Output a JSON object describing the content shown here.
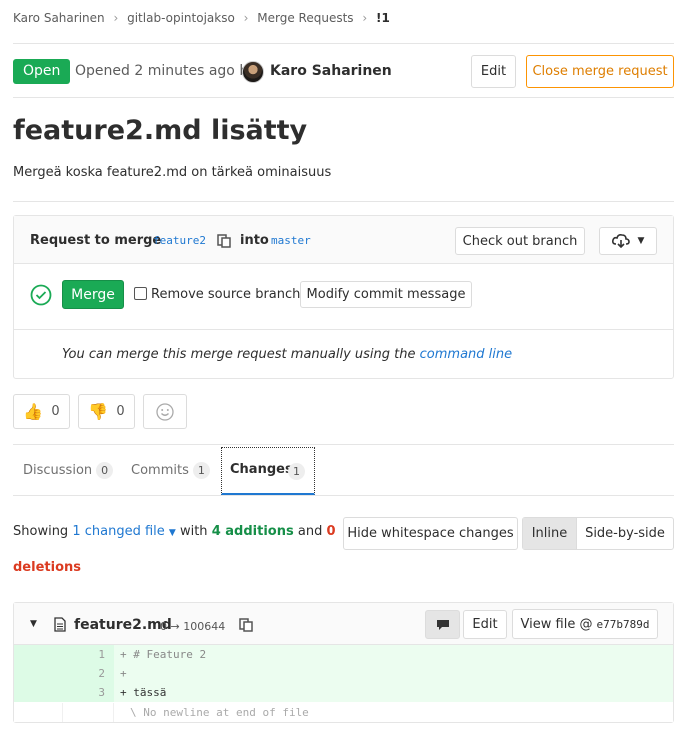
{
  "breadcrumb": {
    "items": [
      "Karo Saharinen",
      "gitlab-opintojakso",
      "Merge Requests",
      "!1"
    ],
    "separator": "›"
  },
  "header": {
    "status": "Open",
    "opened_text": "Opened",
    "time_ago": "2 minutes ago",
    "by_text": "by",
    "author": "Karo Saharinen",
    "edit_label": "Edit",
    "close_label": "Close merge request"
  },
  "title": "feature2.md lisätty",
  "description": "Mergeä koska feature2.md on tärkeä ominaisuus",
  "merge_widget": {
    "request_text": "Request to merge",
    "source_branch": "feature2",
    "into_text": "into",
    "target_branch": "master",
    "checkout_label": "Check out branch",
    "merge_label": "Merge",
    "remove_source_label": "Remove source branch",
    "modify_commit_label": "Modify commit message",
    "manual_text": "You can merge this merge request manually using the",
    "command_line_link": "command line"
  },
  "awards": {
    "thumbs_up": "0",
    "thumbs_down": "0"
  },
  "tabs": [
    {
      "label": "Discussion",
      "count": "0"
    },
    {
      "label": "Commits",
      "count": "1"
    },
    {
      "label": "Changes",
      "count": "1"
    }
  ],
  "diff_summary": {
    "showing": "Showing",
    "changed_files": "1 changed file",
    "with": "with",
    "additions": "4 additions",
    "and": "and",
    "deletions_count": "0",
    "deletions_word": "deletions",
    "hide_whitespace_label": "Hide whitespace changes",
    "inline_label": "Inline",
    "side_by_side_label": "Side-by-side"
  },
  "file": {
    "name": "feature2.md",
    "mode": "0 → 100644",
    "edit_label": "Edit",
    "view_file_label": "View file @",
    "commit_sha": "e77b789d",
    "lines": [
      {
        "num": "1",
        "text": "+ # Feature 2"
      },
      {
        "num": "2",
        "text": "+"
      },
      {
        "num": "3",
        "text": "+ tässä"
      }
    ],
    "no_newline": "\\ No newline at end of file"
  },
  "colors": {
    "accent_green": "#1aaa55",
    "link_blue": "#1f78d1",
    "close_orange": "#fc9403",
    "deletions_red": "#db3b21",
    "diff_added_bg": "#ecfdf0",
    "diff_added_num_bg": "#ddfbe6"
  }
}
